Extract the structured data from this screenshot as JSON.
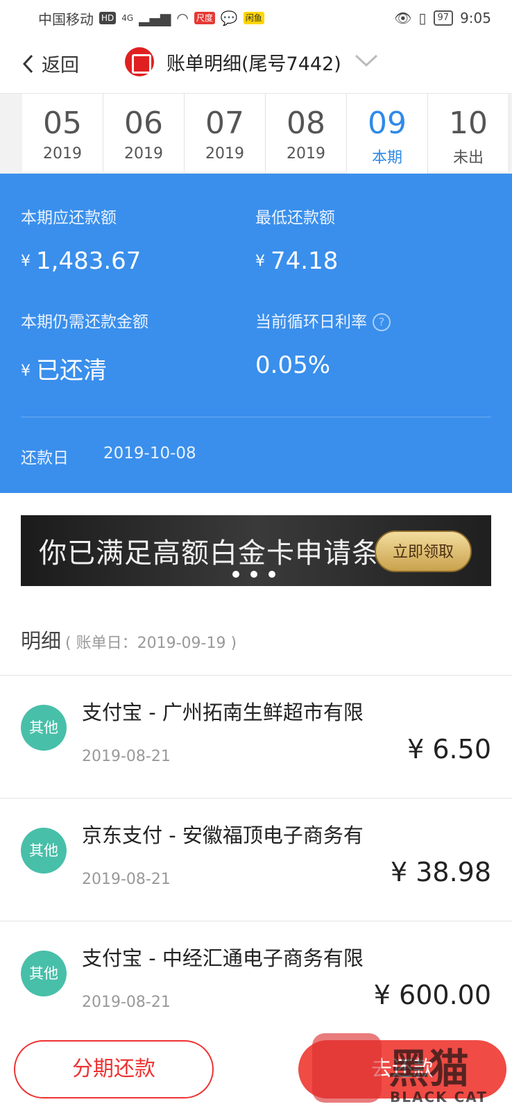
{
  "status_bar": {
    "carrier": "中国移动",
    "hd_badge": "HD",
    "network": "4G",
    "app1_badge": "尺度",
    "app2_badge": "闲鱼",
    "battery": "97",
    "time": "9:05"
  },
  "header": {
    "back_label": "返回",
    "title": "账单明细(尾号7442)"
  },
  "month_tabs": [
    {
      "month": "05",
      "sub": "2019",
      "active": false
    },
    {
      "month": "06",
      "sub": "2019",
      "active": false
    },
    {
      "month": "07",
      "sub": "2019",
      "active": false
    },
    {
      "month": "08",
      "sub": "2019",
      "active": false
    },
    {
      "month": "09",
      "sub": "本期",
      "active": true
    },
    {
      "month": "10",
      "sub": "未出",
      "active": false
    }
  ],
  "summary": {
    "due_label": "本期应还款额",
    "due_yen": "¥",
    "due_value": "1,483.67",
    "min_label": "最低还款额",
    "min_yen": "¥",
    "min_value": "74.18",
    "remaining_label": "本期仍需还款金额",
    "remaining_yen": "¥",
    "remaining_value": "已还清",
    "rate_label": "当前循环日利率",
    "rate_help": "?",
    "rate_value": "0.05%",
    "due_date_label": "还款日",
    "due_date_value": "2019-10-08"
  },
  "banner": {
    "text": "你已满足高额白金卡申请条件",
    "button": "立即领取"
  },
  "detail": {
    "title": "明细",
    "bill_date": "( 账单日：2019-09-19 )"
  },
  "transactions": [
    {
      "tag": "其他",
      "name": "支付宝 - 广州拓南生鲜超市有限",
      "date": "2019-08-21",
      "amount": "¥ 6.50"
    },
    {
      "tag": "其他",
      "name": "京东支付 - 安徽福顶电子商务有",
      "date": "2019-08-21",
      "amount": "¥ 38.98"
    },
    {
      "tag": "其他",
      "name": "支付宝 - 中经汇通电子商务有限",
      "date": "2019-08-21",
      "amount": "¥ 600.00"
    }
  ],
  "actions": {
    "installment": "分期还款",
    "pay": "去还款"
  },
  "watermark": {
    "text": "黑猫",
    "sub": "BLACK CAT"
  }
}
